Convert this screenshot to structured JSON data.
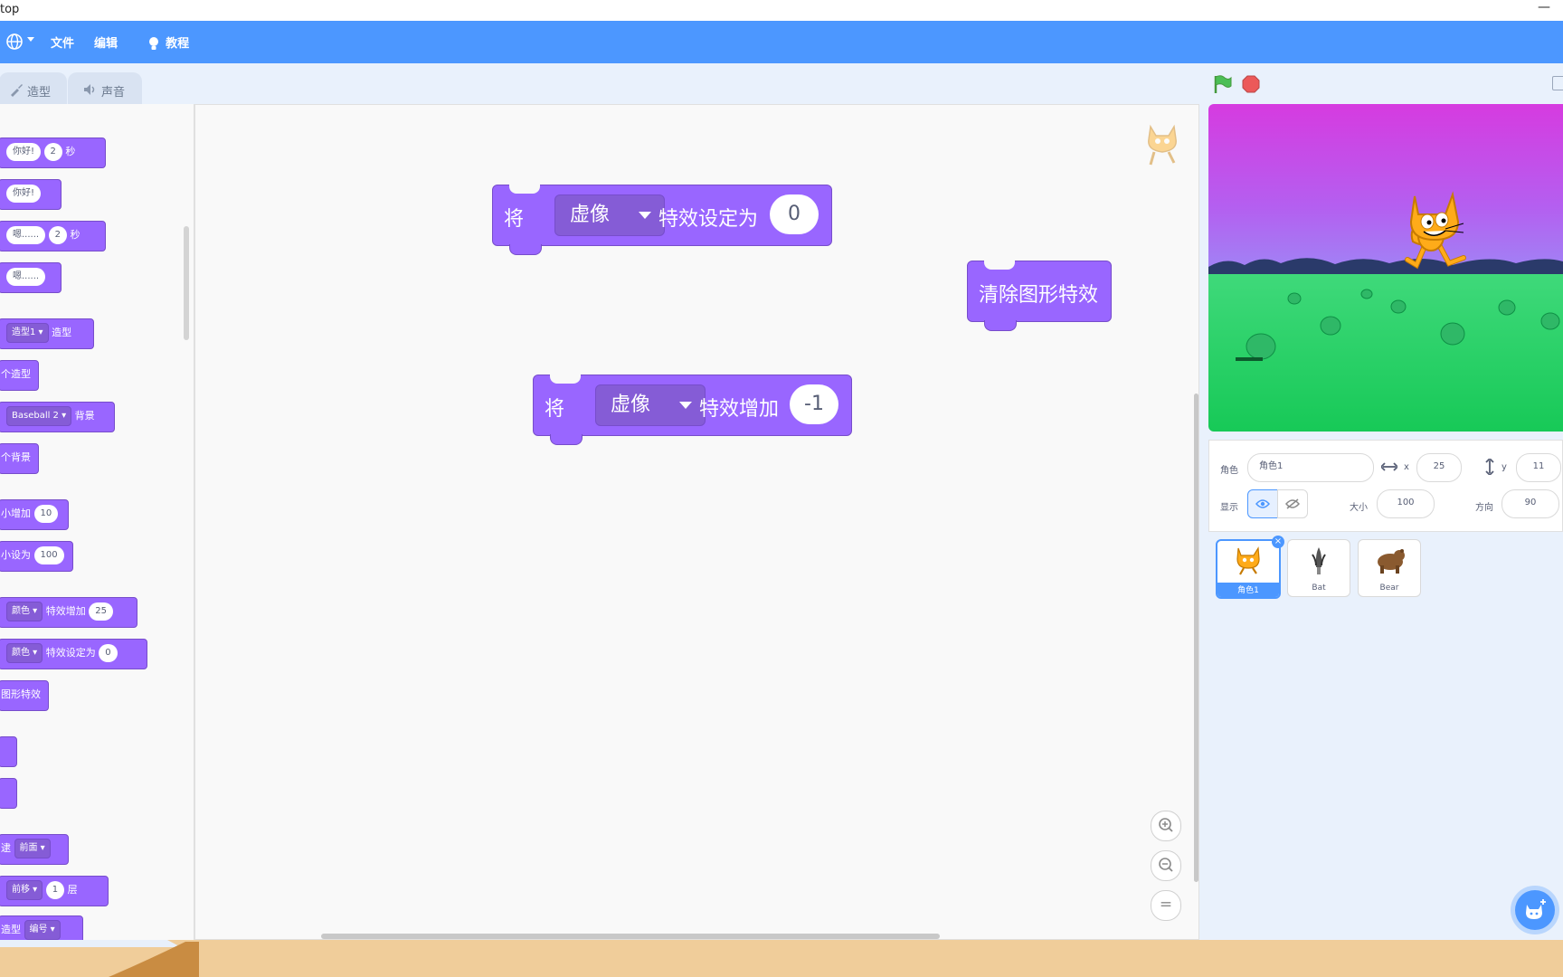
{
  "window": {
    "title": "top",
    "minimize_glyph": "—"
  },
  "menubar": {
    "language_icon": "globe-icon",
    "file_label": "文件",
    "edit_label": "编辑",
    "tutorial_label": "教程",
    "bg_color": "#4c97ff"
  },
  "tabs": {
    "costumes_label": "造型",
    "sounds_label": "声音"
  },
  "palette": {
    "say_secs": {
      "text": "你好!",
      "secs": "2",
      "unit": "秒"
    },
    "say": {
      "text": "你好!"
    },
    "think_secs": {
      "text": "嗯......",
      "secs": "2",
      "unit": "秒"
    },
    "think": {
      "text": "嗯......"
    },
    "switch_costume": {
      "value": "造型1",
      "suffix": "造型"
    },
    "next_costume": {
      "text": "个造型"
    },
    "switch_backdrop": {
      "value": "Baseball 2",
      "suffix": "背景"
    },
    "next_backdrop": {
      "text": "个背景"
    },
    "change_size": {
      "text": "小增加",
      "value": "10"
    },
    "set_size": {
      "text": "小设为",
      "value": "100"
    },
    "change_effect": {
      "effect": "颜色",
      "text": "特效增加",
      "value": "25"
    },
    "set_effect": {
      "effect": "颜色",
      "text": "特效设定为",
      "value": "0"
    },
    "clear_effects": {
      "text": "图形特效"
    },
    "go_to_layer": {
      "prefix": "逮",
      "value": "前面"
    },
    "go_layers": {
      "direction": "前移",
      "value": "1",
      "unit": "层"
    },
    "costume_number": {
      "prefix": "造型",
      "value": "编号"
    }
  },
  "workspace": {
    "block_set_effect": {
      "prefix": "将",
      "effect": "虚像",
      "text": "特效设定为",
      "value": "0"
    },
    "block_clear_effects": {
      "text": "清除图形特效"
    },
    "block_change_effect": {
      "prefix": "将",
      "effect": "虚像",
      "text": "特效增加",
      "value": "-1"
    },
    "zoom_in_icon": "zoom-in-icon",
    "zoom_out_icon": "zoom-out-icon",
    "zoom_reset_label": "="
  },
  "stage": {
    "green_flag_icon": "green-flag-icon",
    "stop_icon": "stop-icon"
  },
  "sprite_info": {
    "sprite_label": "角色",
    "sprite_name": "角色1",
    "x_label": "x",
    "x_value": "25",
    "y_label": "y",
    "y_value": "11",
    "show_label": "显示",
    "size_label": "大小",
    "size_value": "100",
    "direction_label": "方向",
    "direction_value": "90"
  },
  "sprites": [
    {
      "name": "角色1",
      "selected": true
    },
    {
      "name": "Bat",
      "selected": false
    },
    {
      "name": "Bear",
      "selected": false
    }
  ],
  "colors": {
    "looks_block": "#9966ff",
    "looks_border": "#774dcb",
    "accent": "#4c97ff",
    "stop": "#ec5959",
    "flag": "#4cbf56"
  }
}
